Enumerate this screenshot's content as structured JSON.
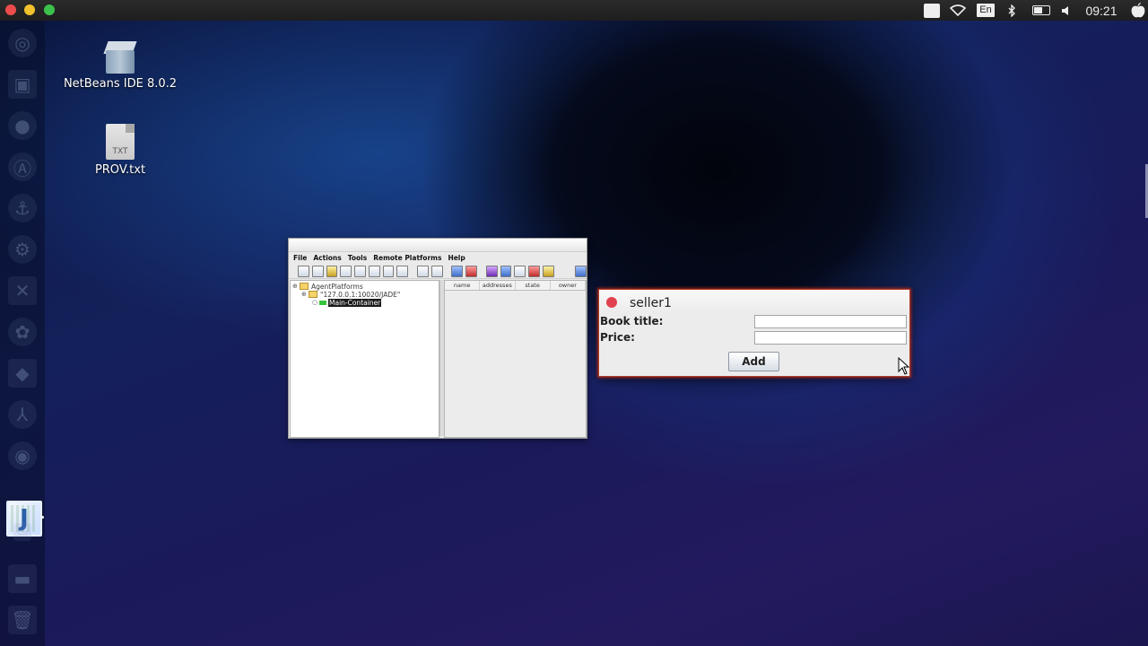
{
  "topbar": {
    "lang": "En",
    "clock": "09:21",
    "icons": [
      "chat-icon",
      "wifi-icon",
      "keyboard-language-icon",
      "bluetooth-icon",
      "battery-icon",
      "volume-icon",
      "apple-icon"
    ]
  },
  "desktop": {
    "icons": [
      {
        "label": "NetBeans IDE 8.0.2",
        "icon": "netbeans-cube-icon"
      },
      {
        "label": "PROV.txt",
        "icon": "text-file-icon",
        "badge": "TXT"
      }
    ]
  },
  "rma": {
    "menu": [
      "File",
      "Actions",
      "Tools",
      "Remote Platforms",
      "Help"
    ],
    "tree": {
      "root": "AgentPlatforms",
      "platform": "\"127.0.0.1:10020/JADE\"",
      "container": "Main-Container"
    },
    "table_columns": [
      "name",
      "addresses",
      "state",
      "owner"
    ]
  },
  "seller": {
    "title": "seller1",
    "book_title_label": "Book title:",
    "price_label": "Price:",
    "book_title_value": "",
    "price_value": "",
    "add_label": "Add"
  }
}
